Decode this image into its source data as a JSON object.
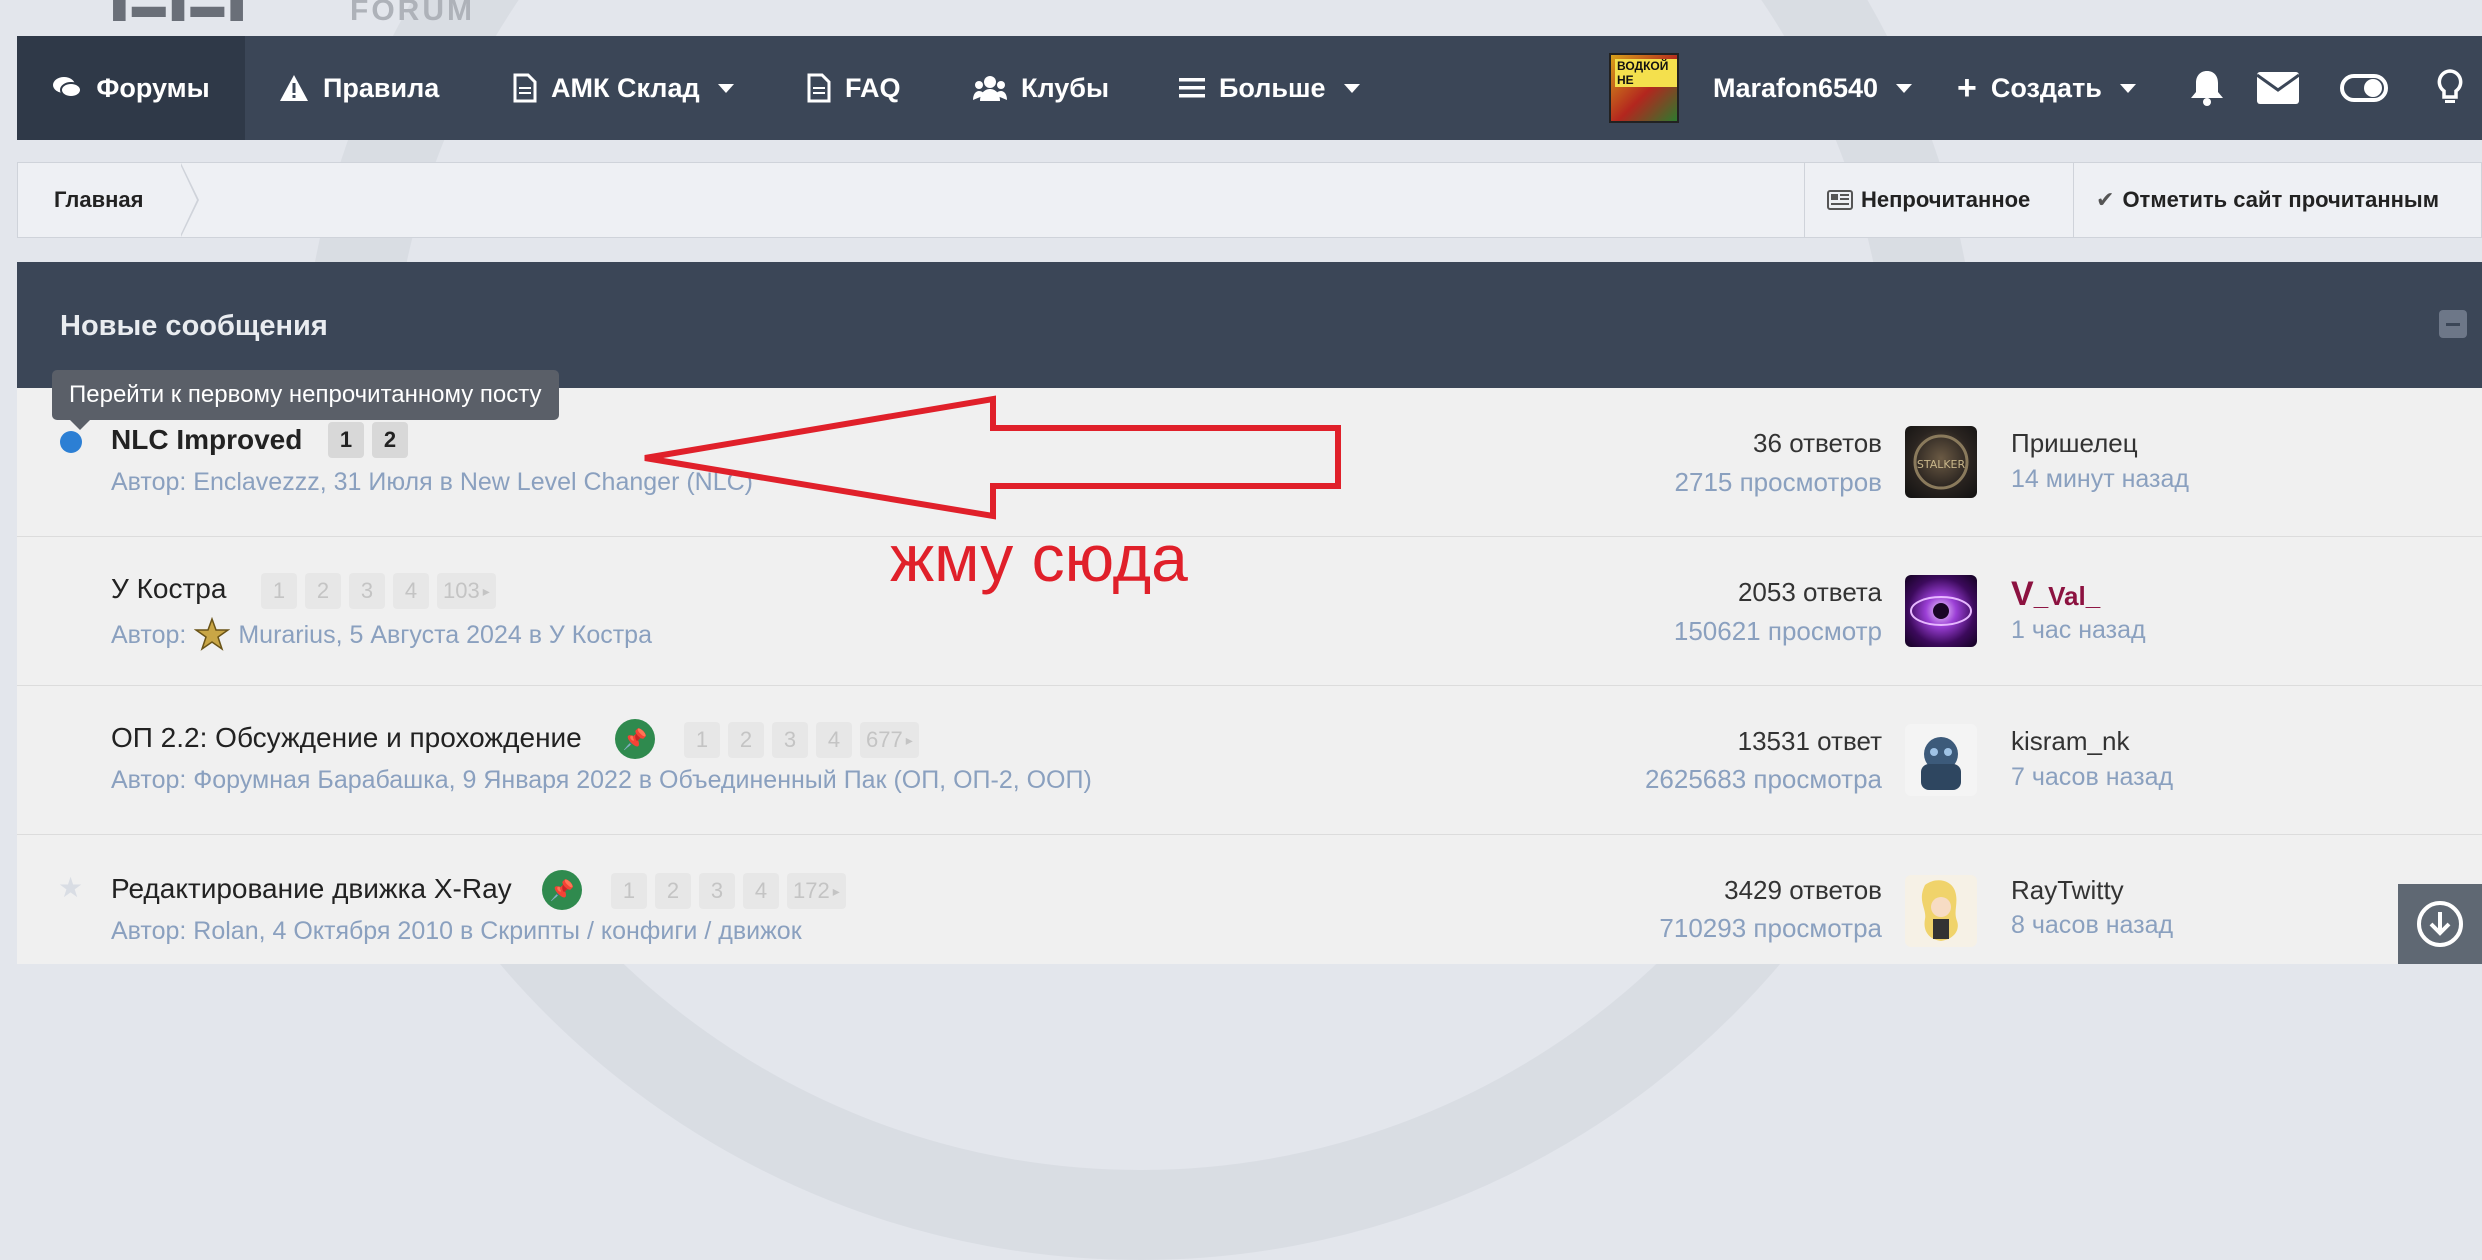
{
  "logo": {
    "text": "▮▬▮▬▮",
    "sub": "FORUM"
  },
  "nav": {
    "forums": "Форумы",
    "rules": "Правила",
    "amk_store": "АМК Склад",
    "faq": "FAQ",
    "clubs": "Клубы",
    "more": "Больше",
    "username": "Marafon6540",
    "create": "Создать",
    "avatar_text": "ВОДКОЙ НЕ"
  },
  "breadcrumb": {
    "home": "Главная",
    "unread": "Непрочитанное",
    "mark_read": "Отметить сайт прочитанным"
  },
  "panel": {
    "title": "Новые сообщения"
  },
  "tooltip": "Перейти к первому непрочитанному посту",
  "annotation": "жму сюда",
  "topics": [
    {
      "title": "NLC Improved",
      "meta": "Автор: Enclavezzz, 31 Июля в New Level Changer (NLC)",
      "pages": [
        "1",
        "2"
      ],
      "answers": "36 ответов",
      "views": "2715 просмотров",
      "last_user": "Пришелец",
      "last_time": "14 минут назад"
    },
    {
      "title": "У Костра",
      "meta_prefix": "Автор:",
      "meta": "Murarius, 5 Августа 2024 в У Костра",
      "pages": [
        "1",
        "2",
        "3",
        "4",
        "103"
      ],
      "answers": "2053 ответа",
      "views": "150621 просмотр",
      "last_user": "_Val_",
      "last_time": "1 час назад"
    },
    {
      "title": "ОП 2.2: Обсуждение и прохождение",
      "meta": "Автор: Форумная Барабашка, 9 Января 2022 в Объединенный Пак (ОП, ОП-2, ООП)",
      "pages": [
        "1",
        "2",
        "3",
        "4",
        "677"
      ],
      "answers": "13531 ответ",
      "views": "2625683 просмотра",
      "last_user": "kisram_nk",
      "last_time": "7 часов назад"
    },
    {
      "title": "Редактирование движка X-Ray",
      "meta": "Автор: Rolan, 4 Октября 2010 в Скрипты / конфиги / движок",
      "pages": [
        "1",
        "2",
        "3",
        "4",
        "172"
      ],
      "answers": "3429 ответов",
      "views": "710293 просмотра",
      "last_user": "RayTwitty",
      "last_time": "8 часов назад"
    }
  ]
}
